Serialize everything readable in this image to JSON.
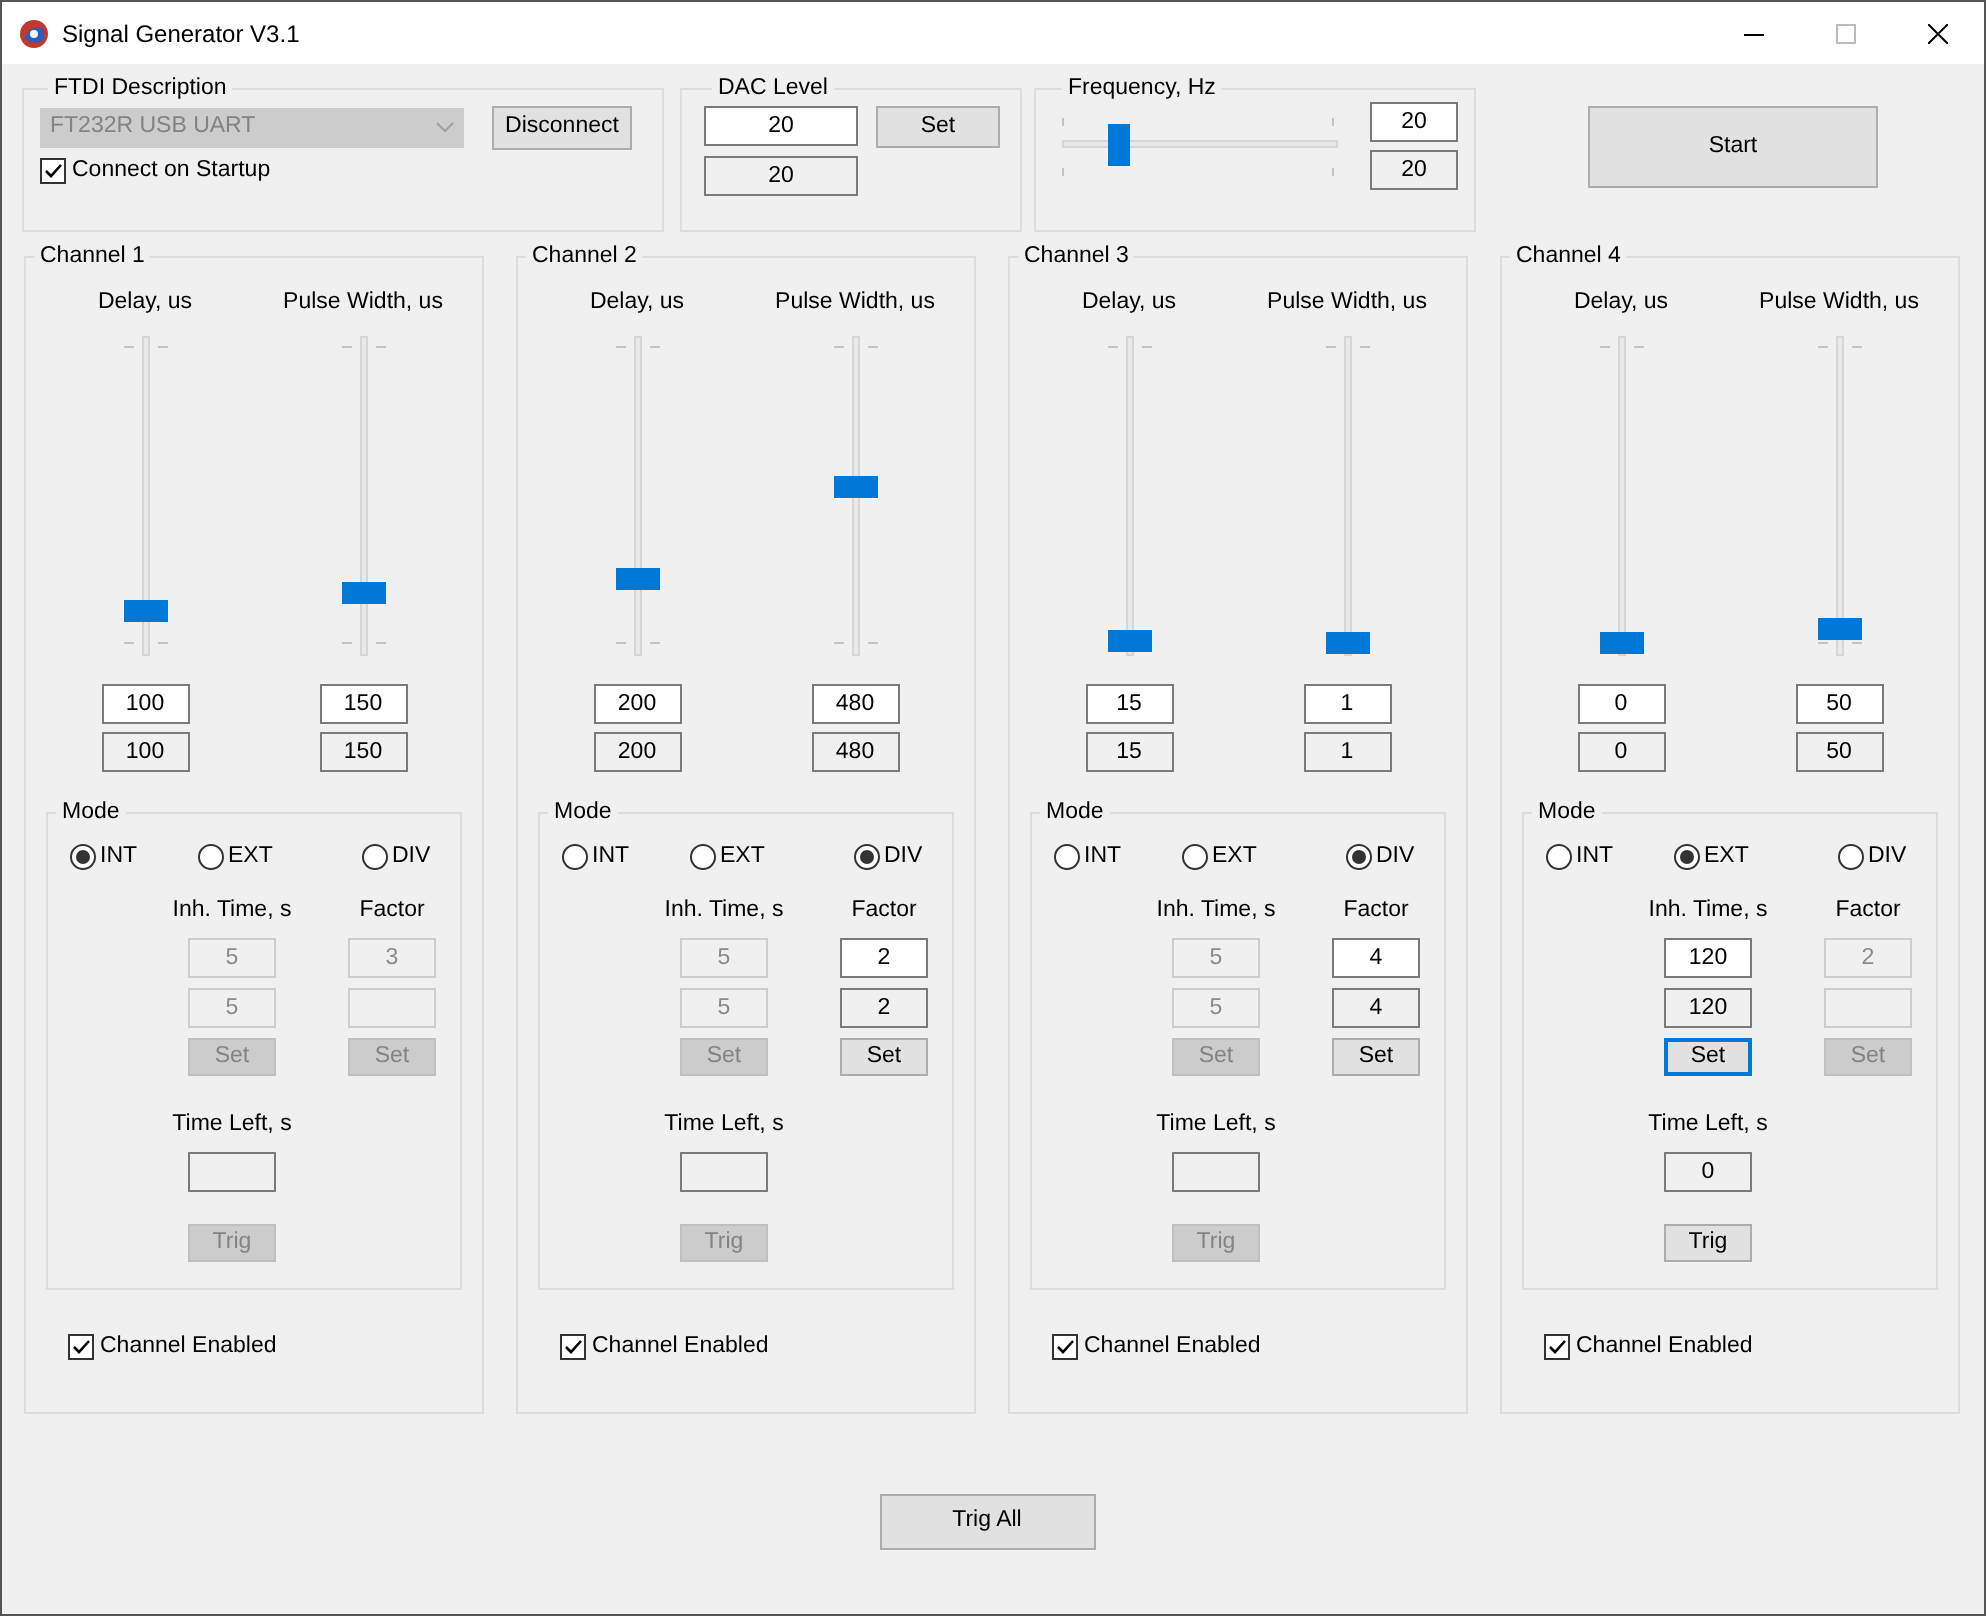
{
  "window": {
    "title": "Signal Generator V3.1"
  },
  "ftdi": {
    "title": "FTDI Description",
    "device": "FT232R USB UART",
    "device_disabled": true,
    "disconnect": "Disconnect",
    "connect_on_startup": {
      "label": "Connect on Startup",
      "checked": true
    }
  },
  "dac": {
    "title": "DAC Level",
    "input": "20",
    "readout": "20",
    "set": "Set"
  },
  "frequency": {
    "title": "Frequency, Hz",
    "level": 0.2,
    "input": "20",
    "readout": "20"
  },
  "start": "Start",
  "channels": [
    {
      "title": "Channel 1",
      "delay": {
        "label": "Delay, us",
        "level": 0.11,
        "input": "100",
        "readout": "100"
      },
      "pulse_width": {
        "label": "Pulse Width, us",
        "level": 0.17,
        "input": "150",
        "readout": "150"
      },
      "mode": {
        "title": "Mode",
        "options": [
          {
            "label": "INT",
            "selected": true
          },
          {
            "label": "EXT",
            "selected": false
          },
          {
            "label": "DIV",
            "selected": false
          }
        ],
        "inhibit": {
          "label": "Inh. Time, s",
          "disabled": true,
          "input": "5",
          "readout": "5",
          "set": {
            "label": "Set",
            "focused": false
          }
        },
        "factor": {
          "label": "Factor",
          "disabled": true,
          "input": "3",
          "set": {
            "label": "Set",
            "focused": false
          }
        },
        "time_left": {
          "label": "Time Left, s"
        },
        "trig": {
          "label": "Trig",
          "disabled": true
        }
      },
      "enabled": {
        "label": "Channel Enabled",
        "checked": true
      }
    },
    {
      "title": "Channel 2",
      "delay": {
        "label": "Delay, us",
        "level": 0.22,
        "input": "200",
        "readout": "200"
      },
      "pulse_width": {
        "label": "Pulse Width, us",
        "level": 0.53,
        "input": "480",
        "readout": "480"
      },
      "mode": {
        "title": "Mode",
        "options": [
          {
            "label": "INT",
            "selected": false
          },
          {
            "label": "EXT",
            "selected": false
          },
          {
            "label": "DIV",
            "selected": true
          }
        ],
        "inhibit": {
          "label": "Inh. Time, s",
          "disabled": true,
          "input": "5",
          "readout": "5",
          "set": {
            "label": "Set",
            "focused": false
          }
        },
        "factor": {
          "label": "Factor",
          "disabled": false,
          "input": "2",
          "readout": "2",
          "set": {
            "label": "Set",
            "focused": false
          }
        },
        "time_left": {
          "label": "Time Left, s"
        },
        "trig": {
          "label": "Trig",
          "disabled": true
        }
      },
      "enabled": {
        "label": "Channel Enabled",
        "checked": true
      }
    },
    {
      "title": "Channel 3",
      "delay": {
        "label": "Delay, us",
        "level": 0.01,
        "input": "15",
        "readout": "15"
      },
      "pulse_width": {
        "label": "Pulse Width, us",
        "level": 0.0,
        "input": "1",
        "readout": "1"
      },
      "mode": {
        "title": "Mode",
        "options": [
          {
            "label": "INT",
            "selected": false
          },
          {
            "label": "EXT",
            "selected": false
          },
          {
            "label": "DIV",
            "selected": true
          }
        ],
        "inhibit": {
          "label": "Inh. Time, s",
          "disabled": true,
          "input": "5",
          "readout": "5",
          "set": {
            "label": "Set",
            "focused": false
          }
        },
        "factor": {
          "label": "Factor",
          "disabled": false,
          "input": "4",
          "readout": "4",
          "set": {
            "label": "Set",
            "focused": false
          }
        },
        "time_left": {
          "label": "Time Left, s"
        },
        "trig": {
          "label": "Trig",
          "disabled": true
        }
      },
      "enabled": {
        "label": "Channel Enabled",
        "checked": true
      }
    },
    {
      "title": "Channel 4",
      "delay": {
        "label": "Delay, us",
        "level": 0.0,
        "input": "0",
        "readout": "0"
      },
      "pulse_width": {
        "label": "Pulse Width, us",
        "level": 0.05,
        "input": "50",
        "readout": "50"
      },
      "mode": {
        "title": "Mode",
        "options": [
          {
            "label": "INT",
            "selected": false
          },
          {
            "label": "EXT",
            "selected": true
          },
          {
            "label": "DIV",
            "selected": false
          }
        ],
        "inhibit": {
          "label": "Inh. Time, s",
          "disabled": false,
          "input": "120",
          "readout": "120",
          "set": {
            "label": "Set",
            "focused": true
          }
        },
        "factor": {
          "label": "Factor",
          "disabled": true,
          "input": "2",
          "set": {
            "label": "Set",
            "focused": false
          }
        },
        "time_left": {
          "label": "Time Left, s",
          "value": "0"
        },
        "trig": {
          "label": "Trig",
          "disabled": false
        }
      },
      "enabled": {
        "label": "Channel Enabled",
        "checked": true
      }
    }
  ],
  "trig_all": "Trig All"
}
